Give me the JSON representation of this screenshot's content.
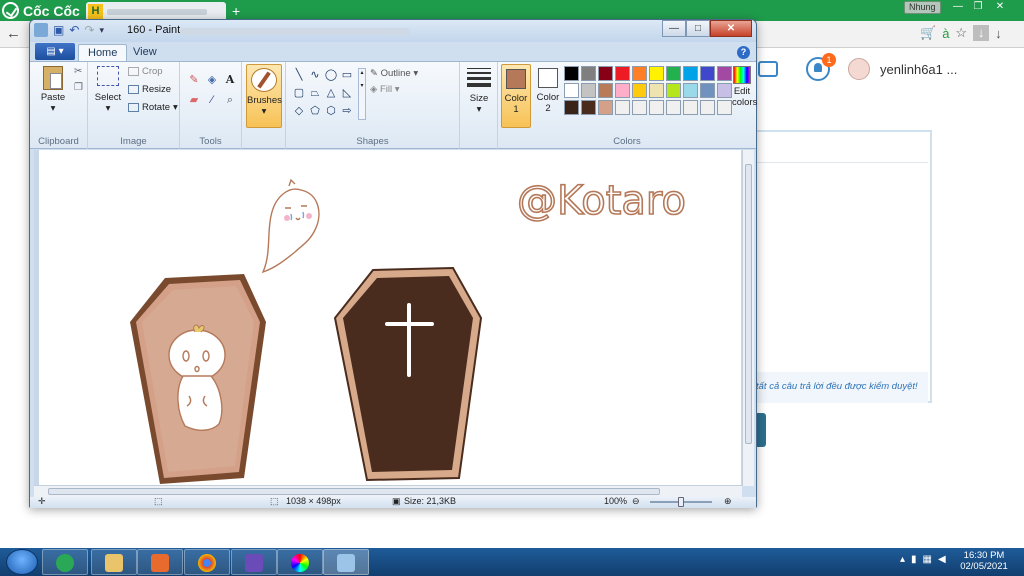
{
  "browser": {
    "name": "Cốc Cốc",
    "tab_favicon": "H",
    "profile_label": "Nhung",
    "user_name": "yenlinh6a1 ...",
    "notification_count": "1",
    "moderation_note": "tất cả câu trả lời đều được kiểm duyệt!"
  },
  "paint": {
    "title": "160 - Paint",
    "tabs": {
      "home": "Home",
      "view": "View"
    },
    "clipboard": {
      "paste": "Paste",
      "group": "Clipboard"
    },
    "image": {
      "select": "Select",
      "crop": "Crop",
      "resize": "Resize",
      "rotate": "Rotate",
      "group": "Image"
    },
    "tools_group": "Tools",
    "brushes": "Brushes",
    "shapes": {
      "outline": "Outline",
      "fill": "Fill",
      "group": "Shapes"
    },
    "size": "Size",
    "colors": {
      "color1": "Color 1",
      "color2": "Color 2",
      "edit": "Edit colors",
      "group": "Colors",
      "color1_value": "#b5795a",
      "color2_value": "#ffffff",
      "palette": [
        "#000000",
        "#7f7f7f",
        "#880015",
        "#ed1c24",
        "#ff7f27",
        "#fff200",
        "#22b14c",
        "#00a2e8",
        "#3f48cc",
        "#a349a4",
        "#ffffff",
        "#c3c3c3",
        "#b97a57",
        "#ffaec9",
        "#ffc90e",
        "#efe4b0",
        "#b5e61d",
        "#99d9ea",
        "#7092be",
        "#c8bfe7",
        "#3a2418",
        "#4a2c1e",
        "#d4a088",
        "#f0f0f0",
        "#f0f0f0",
        "#f0f0f0",
        "#f0f0f0",
        "#f0f0f0",
        "#f0f0f0",
        "#f0f0f0"
      ]
    },
    "canvas": {
      "watermark": "@Kotaro",
      "coffin_brown": "#7a4a2e",
      "coffin_light": "#d6a992",
      "coffin_dark": "#4a2c1e"
    },
    "status": {
      "dimensions": "1038 × 498px",
      "size": "Size: 21,3KB",
      "zoom": "100%"
    }
  },
  "taskbar": {
    "time": "16:30 PM",
    "date": "02/05/2021"
  }
}
